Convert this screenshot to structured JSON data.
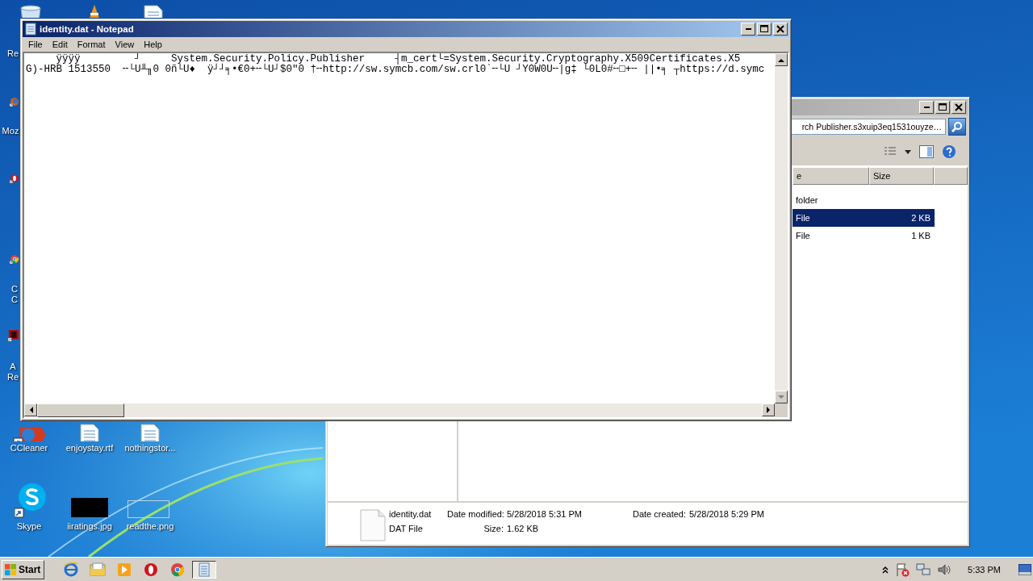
{
  "desktop": {
    "icons": [
      {
        "kind": "recycle-bin",
        "label_lines": [
          "Re"
        ]
      },
      {
        "kind": "cone"
      },
      {
        "kind": "document"
      },
      {
        "kind": "firefox",
        "label_lines": [
          "Moz"
        ]
      },
      {
        "kind": "opera"
      },
      {
        "kind": "chrome",
        "label_lines": [
          "C",
          "C"
        ]
      },
      {
        "kind": "acrobat",
        "label_lines": [
          "A",
          "Re"
        ]
      },
      {
        "kind": "ccleaner",
        "label_lines": [
          "CCleaner"
        ]
      },
      {
        "kind": "document",
        "label_lines": [
          "enjoystay.rtf"
        ]
      },
      {
        "kind": "document",
        "label_lines": [
          "nothingstor..."
        ]
      },
      {
        "kind": "skype",
        "label_lines": [
          "Skype"
        ]
      },
      {
        "kind": "image-thumbnail",
        "label_lines": [
          "iiratings.jpg"
        ]
      },
      {
        "kind": "empty-thumbnail",
        "label_lines": [
          "readthe.png"
        ]
      }
    ]
  },
  "notepad": {
    "title": "identity.dat - Notepad",
    "menu": [
      "File",
      "Edit",
      "Format",
      "View",
      "Help"
    ],
    "lines": [
      "     ÿÿÿÿ         ┘     System.Security.Policy.Publisher     ┤m_cert└=System.Security.Cryptography.X509Certificates.X5",
      "G)-HRB 1513550  ╌└U╨╖0 0ñ└U♦  ÿ┘┘╕•€0+╌└U┘$0\"0 †╌http://sw.symcb.com/sw.crl0`╌└U ┘Y0W0U╌|g‡ └0L0#╌□+╌ ||•╕ ┬https://d.symc"
    ]
  },
  "explorer": {
    "address": "rch Publisher.s3xuip3eq1531ouyze…",
    "columns": [
      "e",
      "Size"
    ],
    "rows": [
      {
        "column_1": "folder",
        "selected": false
      },
      {
        "column_1": "File",
        "size": "2 KB",
        "selected": true
      },
      {
        "column_1": "File",
        "size": "1 KB",
        "selected": false
      }
    ],
    "details": {
      "name": "identity.dat",
      "type": "DAT File",
      "properties": [
        {
          "label": "Date modified:",
          "value": "5/28/2018 5:31 PM"
        },
        {
          "label": "Size:",
          "value": "1.62 KB"
        },
        {
          "label": "Date created:",
          "value": "5/28/2018 5:29 PM"
        }
      ]
    }
  },
  "taskbar": {
    "start": "Start",
    "apps": [
      {
        "kind": "ie",
        "active": false
      },
      {
        "kind": "folder",
        "active": false
      },
      {
        "kind": "media",
        "active": false
      },
      {
        "kind": "opera",
        "active": false
      },
      {
        "kind": "chrome",
        "active": false
      },
      {
        "kind": "notepad",
        "active": true
      }
    ],
    "clock": "5:33 PM"
  }
}
